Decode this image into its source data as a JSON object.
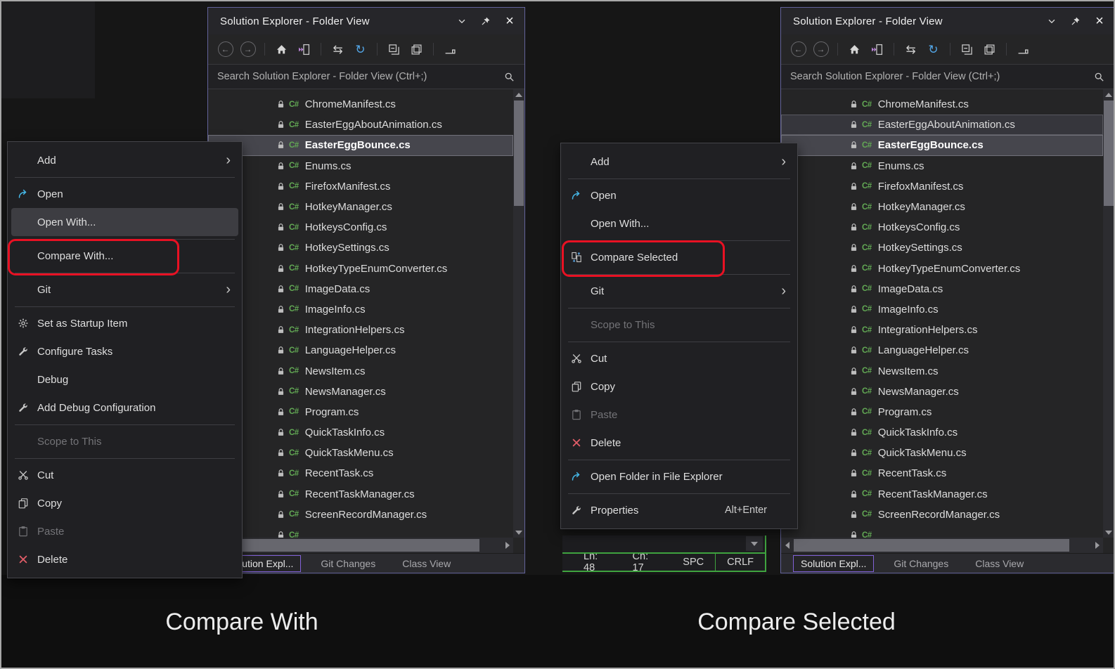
{
  "window": {
    "title": "Solution Explorer - Folder View",
    "search_placeholder": "Search Solution Explorer - Folder View (Ctrl+;)",
    "file_type_badge": "C#",
    "titlebar_icons": [
      "chevron-down",
      "pin",
      "close"
    ],
    "toolbar_icons": [
      "back",
      "forward",
      "home",
      "sync-active-document",
      "switch-views",
      "refresh",
      "collapse-all",
      "show-all-files",
      "preview-selected-items"
    ],
    "tabs": [
      {
        "label": "Solution Expl...",
        "active": true
      },
      {
        "label": "Git Changes",
        "active": false
      },
      {
        "label": "Class View",
        "active": false
      }
    ]
  },
  "files": [
    "ChromeManifest.cs",
    "EasterEggAboutAnimation.cs",
    "EasterEggBounce.cs",
    "Enums.cs",
    "FirefoxManifest.cs",
    "HotkeyManager.cs",
    "HotkeysConfig.cs",
    "HotkeySettings.cs",
    "HotkeyTypeEnumConverter.cs",
    "ImageData.cs",
    "ImageInfo.cs",
    "IntegrationHelpers.cs",
    "LanguageHelper.cs",
    "NewsItem.cs",
    "NewsManager.cs",
    "Program.cs",
    "QuickTaskInfo.cs",
    "QuickTaskMenu.cs",
    "RecentTask.cs",
    "RecentTaskManager.cs",
    "ScreenRecordManager.cs"
  ],
  "left_panel": {
    "selection": {
      "EasterEggBounce.cs": "focused"
    },
    "partial_bottom_row": true
  },
  "right_panel": {
    "selection": {
      "EasterEggAboutAnimation.cs": "selected",
      "EasterEggBounce.cs": "focused"
    },
    "partial_bottom_row": true
  },
  "left_menu": {
    "items": [
      {
        "label": "Add",
        "submenu": true
      },
      {
        "separator": true
      },
      {
        "label": "Open",
        "icon": "open-arrow"
      },
      {
        "label": "Open With...",
        "hover": true
      },
      {
        "separator": true
      },
      {
        "label": "Compare With...",
        "annotated": true
      },
      {
        "separator": true
      },
      {
        "label": "Git",
        "submenu": true
      },
      {
        "separator": true
      },
      {
        "label": "Set as Startup Item",
        "icon": "gear"
      },
      {
        "label": "Configure Tasks",
        "icon": "wrench"
      },
      {
        "label": "Debug"
      },
      {
        "label": "Add Debug Configuration",
        "icon": "wrench"
      },
      {
        "separator": true
      },
      {
        "label": "Scope to This",
        "disabled": true
      },
      {
        "separator": true
      },
      {
        "label": "Cut",
        "icon": "scissors"
      },
      {
        "label": "Copy",
        "icon": "copy"
      },
      {
        "label": "Paste",
        "icon": "paste",
        "disabled": true
      },
      {
        "label": "Delete",
        "icon": "delete"
      }
    ]
  },
  "right_menu": {
    "items": [
      {
        "label": "Add",
        "submenu": true
      },
      {
        "separator": true
      },
      {
        "label": "Open",
        "icon": "open-arrow"
      },
      {
        "label": "Open With..."
      },
      {
        "separator": true
      },
      {
        "label": "Compare Selected",
        "icon": "compare",
        "annotated": true
      },
      {
        "separator": true
      },
      {
        "label": "Git",
        "submenu": true
      },
      {
        "separator": true
      },
      {
        "label": "Scope to This",
        "disabled": true
      },
      {
        "separator": true
      },
      {
        "label": "Cut",
        "icon": "scissors"
      },
      {
        "label": "Copy",
        "icon": "copy"
      },
      {
        "label": "Paste",
        "icon": "paste",
        "disabled": true
      },
      {
        "label": "Delete",
        "icon": "delete"
      },
      {
        "separator": true
      },
      {
        "label": "Open Folder in File Explorer",
        "icon": "open-arrow"
      },
      {
        "separator": true
      },
      {
        "label": "Properties",
        "icon": "wrench",
        "shortcut": "Alt+Enter"
      }
    ]
  },
  "status_bar": {
    "items": [
      "Ln: 48",
      "Ch: 17",
      "SPC",
      "CRLF"
    ]
  },
  "captions": {
    "left": "Compare With",
    "right": "Compare Selected"
  },
  "colors": {
    "annotation_red": "#e81123",
    "accent_purple": "#8262d8",
    "csharp_green": "#62a854",
    "status_green": "#3fa33f",
    "refresh_blue": "#53a7e8",
    "open_arrow_blue": "#45b8e8",
    "delete_red": "#e25d68",
    "sync_purple": "#c18ae0"
  }
}
